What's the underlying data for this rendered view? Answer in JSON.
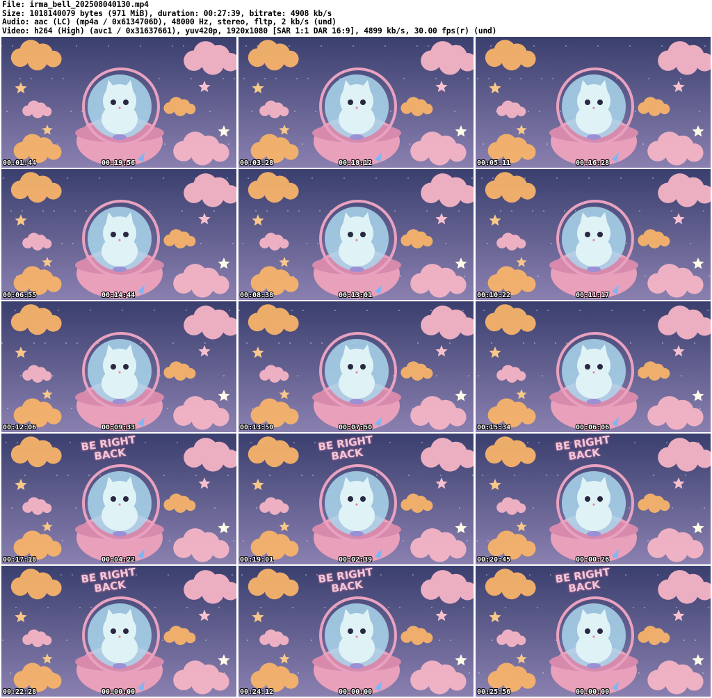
{
  "header": {
    "file": "File: irma_bell_202508040130.mp4",
    "size": "Size: 1018140079 bytes (971 MiB), duration: 00:27:39, bitrate: 4908 kb/s",
    "audio": "Audio: aac (LC) (mp4a / 0x6134706D), 48000 Hz, stereo, fltp, 2 kb/s (und)",
    "video": "Video: h264 (High) (avc1 / 0x31637661), yuv420p, 1920x1080 [SAR 1:1 DAR 16:9], 4899 kb/s, 30.00 fps(r) (und)"
  },
  "colors": {
    "sky_top": "#3a3f6e",
    "sky_bottom": "#8a80b0",
    "cloud_orange": "#f7b36a",
    "cloud_pink": "#f5b5c6",
    "star": "#f8c88a",
    "ufo_pink": "#e9a0bb",
    "dome": "#a9d6ec",
    "cat": "#dff3f7",
    "brb_text": "#f0c8d8"
  },
  "frames": [
    {
      "elapsed": "00:01:44",
      "remaining": "00:19:56",
      "overlay": ""
    },
    {
      "elapsed": "00:03:28",
      "remaining": "00:18:12",
      "overlay": ""
    },
    {
      "elapsed": "00:05:11",
      "remaining": "00:16:28",
      "overlay": ""
    },
    {
      "elapsed": "00:06:55",
      "remaining": "00:14:44",
      "overlay": ""
    },
    {
      "elapsed": "00:08:38",
      "remaining": "00:13:01",
      "overlay": ""
    },
    {
      "elapsed": "00:10:22",
      "remaining": "00:11:17",
      "overlay": ""
    },
    {
      "elapsed": "00:12:06",
      "remaining": "00:09:33",
      "overlay": ""
    },
    {
      "elapsed": "00:13:50",
      "remaining": "00:07:50",
      "overlay": ""
    },
    {
      "elapsed": "00:15:34",
      "remaining": "00:06:06",
      "overlay": ""
    },
    {
      "elapsed": "00:17:18",
      "remaining": "00:04:22",
      "overlay": "BE RIGHT BACK"
    },
    {
      "elapsed": "00:19:01",
      "remaining": "00:02:39",
      "overlay": "BE RIGHT BACK"
    },
    {
      "elapsed": "00:20:45",
      "remaining": "00:00:26",
      "overlay": "BE RIGHT BACK"
    },
    {
      "elapsed": "00:22:28",
      "remaining": "00:00:00",
      "overlay": "BE RIGHT BACK"
    },
    {
      "elapsed": "00:24:12",
      "remaining": "00:00:00",
      "overlay": "BE RIGHT BACK"
    },
    {
      "elapsed": "00:25:56",
      "remaining": "00:00:00",
      "overlay": "BE RIGHT BACK"
    }
  ]
}
